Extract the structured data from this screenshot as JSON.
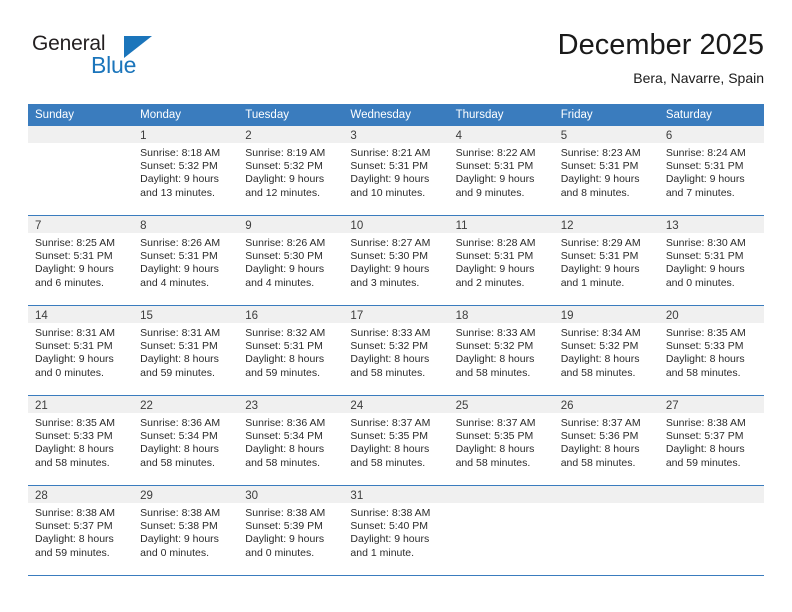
{
  "logo": {
    "general_text": "General",
    "blue_text": "Blue",
    "triangle_color": "#1b75bb",
    "general_color": "#231f20"
  },
  "header": {
    "title": "December 2025",
    "subtitle": "Bera, Navarre, Spain"
  },
  "theme": {
    "header_row_bg": "#3a7cbe",
    "daynum_bar_bg": "#f0f0f0",
    "row_divider": "#3a7cbe",
    "text": "#2b2b2b"
  },
  "weekdays": [
    "Sunday",
    "Monday",
    "Tuesday",
    "Wednesday",
    "Thursday",
    "Friday",
    "Saturday"
  ],
  "weeks": [
    [
      {
        "day": "",
        "sunrise": "",
        "sunset": "",
        "daylight": "",
        "empty": true
      },
      {
        "day": "1",
        "sunrise": "Sunrise: 8:18 AM",
        "sunset": "Sunset: 5:32 PM",
        "daylight": "Daylight: 9 hours and 13 minutes."
      },
      {
        "day": "2",
        "sunrise": "Sunrise: 8:19 AM",
        "sunset": "Sunset: 5:32 PM",
        "daylight": "Daylight: 9 hours and 12 minutes."
      },
      {
        "day": "3",
        "sunrise": "Sunrise: 8:21 AM",
        "sunset": "Sunset: 5:31 PM",
        "daylight": "Daylight: 9 hours and 10 minutes."
      },
      {
        "day": "4",
        "sunrise": "Sunrise: 8:22 AM",
        "sunset": "Sunset: 5:31 PM",
        "daylight": "Daylight: 9 hours and 9 minutes."
      },
      {
        "day": "5",
        "sunrise": "Sunrise: 8:23 AM",
        "sunset": "Sunset: 5:31 PM",
        "daylight": "Daylight: 9 hours and 8 minutes."
      },
      {
        "day": "6",
        "sunrise": "Sunrise: 8:24 AM",
        "sunset": "Sunset: 5:31 PM",
        "daylight": "Daylight: 9 hours and 7 minutes."
      }
    ],
    [
      {
        "day": "7",
        "sunrise": "Sunrise: 8:25 AM",
        "sunset": "Sunset: 5:31 PM",
        "daylight": "Daylight: 9 hours and 6 minutes."
      },
      {
        "day": "8",
        "sunrise": "Sunrise: 8:26 AM",
        "sunset": "Sunset: 5:31 PM",
        "daylight": "Daylight: 9 hours and 4 minutes."
      },
      {
        "day": "9",
        "sunrise": "Sunrise: 8:26 AM",
        "sunset": "Sunset: 5:30 PM",
        "daylight": "Daylight: 9 hours and 4 minutes."
      },
      {
        "day": "10",
        "sunrise": "Sunrise: 8:27 AM",
        "sunset": "Sunset: 5:30 PM",
        "daylight": "Daylight: 9 hours and 3 minutes."
      },
      {
        "day": "11",
        "sunrise": "Sunrise: 8:28 AM",
        "sunset": "Sunset: 5:31 PM",
        "daylight": "Daylight: 9 hours and 2 minutes."
      },
      {
        "day": "12",
        "sunrise": "Sunrise: 8:29 AM",
        "sunset": "Sunset: 5:31 PM",
        "daylight": "Daylight: 9 hours and 1 minute."
      },
      {
        "day": "13",
        "sunrise": "Sunrise: 8:30 AM",
        "sunset": "Sunset: 5:31 PM",
        "daylight": "Daylight: 9 hours and 0 minutes."
      }
    ],
    [
      {
        "day": "14",
        "sunrise": "Sunrise: 8:31 AM",
        "sunset": "Sunset: 5:31 PM",
        "daylight": "Daylight: 9 hours and 0 minutes."
      },
      {
        "day": "15",
        "sunrise": "Sunrise: 8:31 AM",
        "sunset": "Sunset: 5:31 PM",
        "daylight": "Daylight: 8 hours and 59 minutes."
      },
      {
        "day": "16",
        "sunrise": "Sunrise: 8:32 AM",
        "sunset": "Sunset: 5:31 PM",
        "daylight": "Daylight: 8 hours and 59 minutes."
      },
      {
        "day": "17",
        "sunrise": "Sunrise: 8:33 AM",
        "sunset": "Sunset: 5:32 PM",
        "daylight": "Daylight: 8 hours and 58 minutes."
      },
      {
        "day": "18",
        "sunrise": "Sunrise: 8:33 AM",
        "sunset": "Sunset: 5:32 PM",
        "daylight": "Daylight: 8 hours and 58 minutes."
      },
      {
        "day": "19",
        "sunrise": "Sunrise: 8:34 AM",
        "sunset": "Sunset: 5:32 PM",
        "daylight": "Daylight: 8 hours and 58 minutes."
      },
      {
        "day": "20",
        "sunrise": "Sunrise: 8:35 AM",
        "sunset": "Sunset: 5:33 PM",
        "daylight": "Daylight: 8 hours and 58 minutes."
      }
    ],
    [
      {
        "day": "21",
        "sunrise": "Sunrise: 8:35 AM",
        "sunset": "Sunset: 5:33 PM",
        "daylight": "Daylight: 8 hours and 58 minutes."
      },
      {
        "day": "22",
        "sunrise": "Sunrise: 8:36 AM",
        "sunset": "Sunset: 5:34 PM",
        "daylight": "Daylight: 8 hours and 58 minutes."
      },
      {
        "day": "23",
        "sunrise": "Sunrise: 8:36 AM",
        "sunset": "Sunset: 5:34 PM",
        "daylight": "Daylight: 8 hours and 58 minutes."
      },
      {
        "day": "24",
        "sunrise": "Sunrise: 8:37 AM",
        "sunset": "Sunset: 5:35 PM",
        "daylight": "Daylight: 8 hours and 58 minutes."
      },
      {
        "day": "25",
        "sunrise": "Sunrise: 8:37 AM",
        "sunset": "Sunset: 5:35 PM",
        "daylight": "Daylight: 8 hours and 58 minutes."
      },
      {
        "day": "26",
        "sunrise": "Sunrise: 8:37 AM",
        "sunset": "Sunset: 5:36 PM",
        "daylight": "Daylight: 8 hours and 58 minutes."
      },
      {
        "day": "27",
        "sunrise": "Sunrise: 8:38 AM",
        "sunset": "Sunset: 5:37 PM",
        "daylight": "Daylight: 8 hours and 59 minutes."
      }
    ],
    [
      {
        "day": "28",
        "sunrise": "Sunrise: 8:38 AM",
        "sunset": "Sunset: 5:37 PM",
        "daylight": "Daylight: 8 hours and 59 minutes."
      },
      {
        "day": "29",
        "sunrise": "Sunrise: 8:38 AM",
        "sunset": "Sunset: 5:38 PM",
        "daylight": "Daylight: 9 hours and 0 minutes."
      },
      {
        "day": "30",
        "sunrise": "Sunrise: 8:38 AM",
        "sunset": "Sunset: 5:39 PM",
        "daylight": "Daylight: 9 hours and 0 minutes."
      },
      {
        "day": "31",
        "sunrise": "Sunrise: 8:38 AM",
        "sunset": "Sunset: 5:40 PM",
        "daylight": "Daylight: 9 hours and 1 minute."
      },
      {
        "day": "",
        "sunrise": "",
        "sunset": "",
        "daylight": "",
        "empty": true
      },
      {
        "day": "",
        "sunrise": "",
        "sunset": "",
        "daylight": "",
        "empty": true
      },
      {
        "day": "",
        "sunrise": "",
        "sunset": "",
        "daylight": "",
        "empty": true
      }
    ]
  ]
}
